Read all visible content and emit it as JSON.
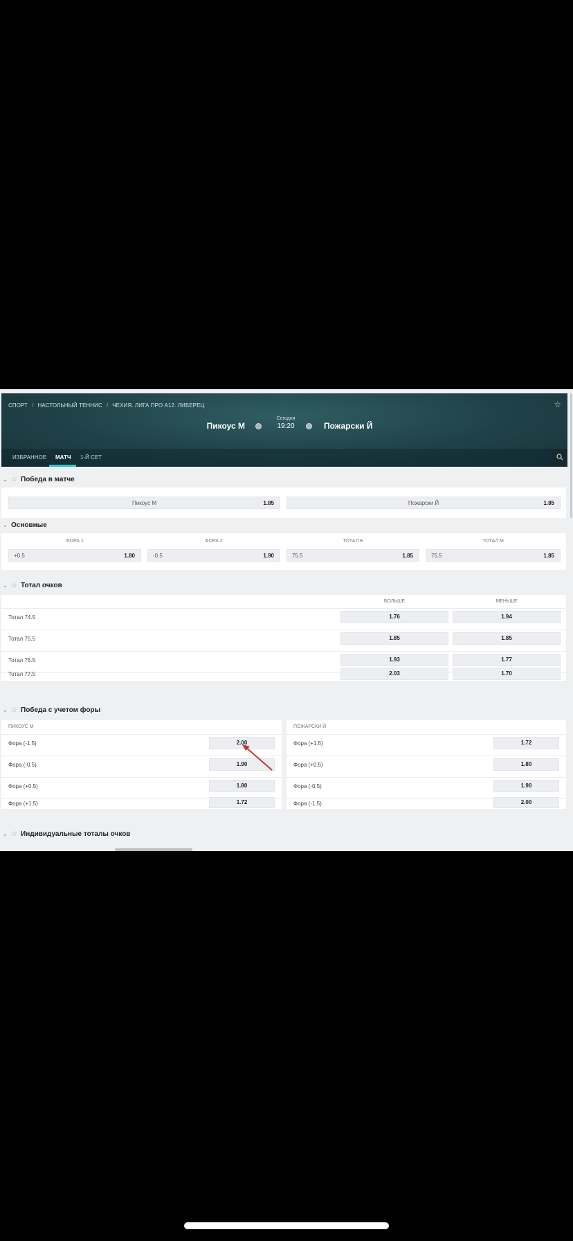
{
  "header": {
    "breadcrumb": [
      "СПОРТ",
      "НАСТОЛЬНЫЙ ТЕННИС",
      "ЧЕХИЯ. ЛИГА ПРО A12. ЛИБЕРЕЦ"
    ],
    "team_home": "Пикоус М",
    "team_away": "Пожарски Й",
    "date": "Сегодня",
    "time": "19:20",
    "tabs": [
      "ИЗБРАННОЕ",
      "МАТЧ",
      "1-Й СЕТ"
    ]
  },
  "match_winner": {
    "title": "Победа в матче",
    "options": [
      {
        "label": "Пикоус М",
        "odd": "1.85"
      },
      {
        "label": "Пожарски Й",
        "odd": "1.85"
      }
    ]
  },
  "main": {
    "title": "Основные",
    "columns": [
      "ФОРА 1",
      "ФОРА 2",
      "ТОТАЛ Б",
      "ТОТАЛ М"
    ],
    "cells": [
      {
        "label": "+0.5",
        "odd": "1.80"
      },
      {
        "label": "-0.5",
        "odd": "1.90"
      },
      {
        "label": "75.5",
        "odd": "1.85"
      },
      {
        "label": "75.5",
        "odd": "1.85"
      }
    ]
  },
  "totals": {
    "title": "Тотал очков",
    "col_over": "БОЛЬШЕ",
    "col_under": "МЕНЬШЕ",
    "rows": [
      {
        "label": "Тотал 74.5",
        "over": "1.76",
        "under": "1.94"
      },
      {
        "label": "Тотал 75.5",
        "over": "1.85",
        "under": "1.85"
      },
      {
        "label": "Тотал 76.5",
        "over": "1.93",
        "under": "1.77"
      },
      {
        "label": "Тотал 77.5",
        "over": "2.03",
        "under": "1.70"
      }
    ]
  },
  "handicap": {
    "title": "Победа с учетом форы",
    "home_header": "ПИКОУС М",
    "away_header": "ПОЖАРСКИ Й",
    "home_rows": [
      {
        "label": "Фора (-1.5)",
        "odd": "2.00"
      },
      {
        "label": "Фора (-0.5)",
        "odd": "1.90"
      },
      {
        "label": "Фора (+0.5)",
        "odd": "1.80"
      },
      {
        "label": "Фора (+1.5)",
        "odd": "1.72"
      }
    ],
    "away_rows": [
      {
        "label": "Фора (+1.5)",
        "odd": "1.72"
      },
      {
        "label": "Фора (+0.5)",
        "odd": "1.80"
      },
      {
        "label": "Фора (-0.5)",
        "odd": "1.90"
      },
      {
        "label": "Фора (-1.5)",
        "odd": "2.00"
      }
    ]
  },
  "individual_totals": {
    "title": "Индивидуальные тоталы очков"
  },
  "colors": {
    "header_bg": "#1f4248",
    "tab_accent": "#2ec5c9",
    "annotation_arrow": "#c0392b"
  }
}
